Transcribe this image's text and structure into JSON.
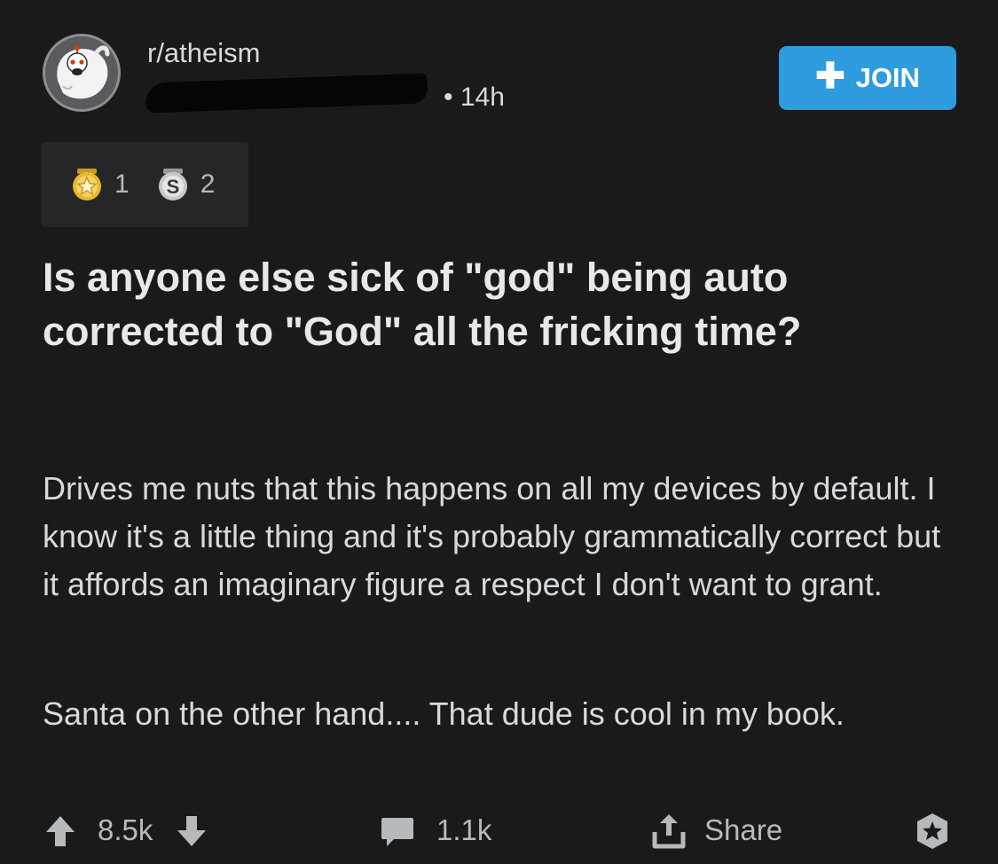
{
  "post": {
    "subreddit": "r/atheism",
    "separator": "•",
    "time": "14h",
    "join_label": "JOIN",
    "awards": [
      {
        "icon": "gold-award-icon",
        "count": "1"
      },
      {
        "icon": "silver-award-icon",
        "count": "2"
      }
    ],
    "title": "Is anyone else sick of \"god\" being auto corrected to \"God\" all the fricking time?",
    "body": [
      "Drives me nuts that this happens on all my devices by default. I know it's a little thing and it's probably grammatically correct but it affords an imaginary figure a respect I don't want to grant.",
      "Santa on the other hand.... That dude is cool in my book."
    ]
  },
  "actions": {
    "score": "8.5k",
    "comments": "1.1k",
    "share_label": "Share"
  },
  "colors": {
    "background": "#1a1a1b",
    "join_button": "#2e9cde",
    "gold": "#e8b830",
    "silver": "#c8c8c8"
  }
}
